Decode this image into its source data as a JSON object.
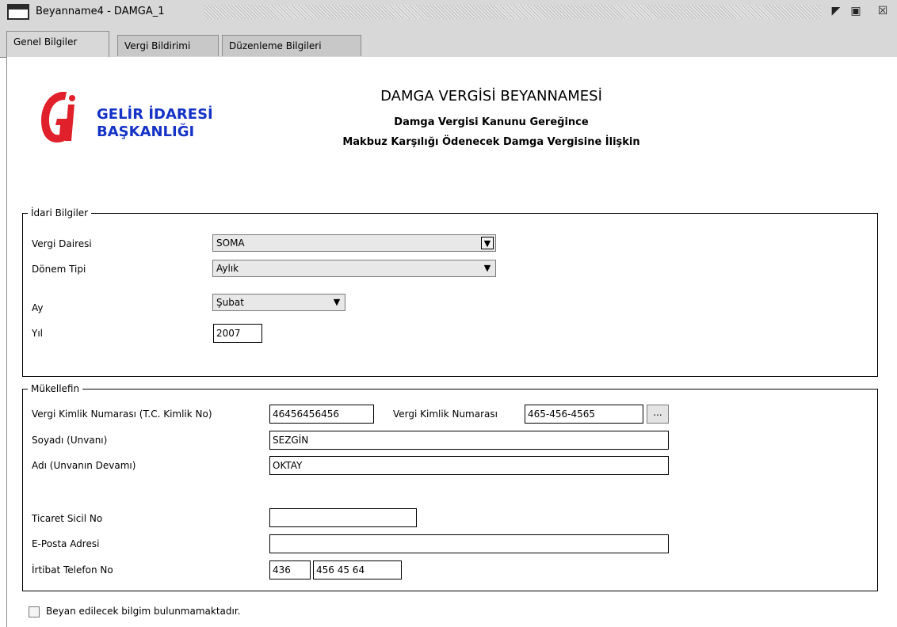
{
  "window": {
    "title": "Beyanname4 - DAMGA_1",
    "icon": "window-icon",
    "controls": [
      "restore-icon",
      "maximize-icon",
      "close-icon"
    ]
  },
  "tabs": [
    {
      "label": "Genel Bilgiler",
      "active": true
    },
    {
      "label": "Vergi Bildirimi",
      "active": false
    },
    {
      "label": "Düzenleme Bilgileri",
      "active": false
    }
  ],
  "header": {
    "logo_line1": "GELİR İDARESİ",
    "logo_line2": "BAŞKANLIĞI",
    "title": "DAMGA VERGİSİ BEYANNAMESİ",
    "subtitle1": "Damga Vergisi Kanunu Gereğince",
    "subtitle2": "Makbuz Karşılığı Ödenecek Damga Vergisine İlişkin"
  },
  "idari": {
    "legend": "İdari Bilgiler",
    "vergi_dairesi_label": "Vergi Dairesi",
    "vergi_dairesi_value": "SOMA",
    "donem_tipi_label": "Dönem Tipi",
    "donem_tipi_value": "Aylık",
    "ay_label": "Ay",
    "ay_value": "Şubat",
    "yil_label": "Yıl",
    "yil_value": "2007"
  },
  "mukellef": {
    "legend": "Mükellefin",
    "tckn_label": "Vergi Kimlik Numarası (T.C. Kimlik No)",
    "tckn_value": "46456456456",
    "vkn_label": "Vergi Kimlik Numarası",
    "vkn_value": "465-456-4565",
    "lookup_button": "...",
    "soyadi_label": "Soyadı (Unvanı)",
    "soyadi_value": "SEZGİN",
    "adi_label": "Adı (Unvanın Devamı)",
    "adi_value": "OKTAY",
    "ticaret_label": "Ticaret Sicil No",
    "ticaret_value": "",
    "eposta_label": "E-Posta Adresi",
    "eposta_value": "",
    "telefon_label": "İrtibat Telefon No",
    "telefon_code": "436",
    "telefon_number": "456 45 64"
  },
  "footer": {
    "checkbox_label": "Beyan edilecek bilgim bulunmamaktadır.",
    "checked": false
  },
  "colors": {
    "logo_red": "#e0202a",
    "logo_blue": "#1533c6",
    "chrome": "#d8d8d8"
  }
}
